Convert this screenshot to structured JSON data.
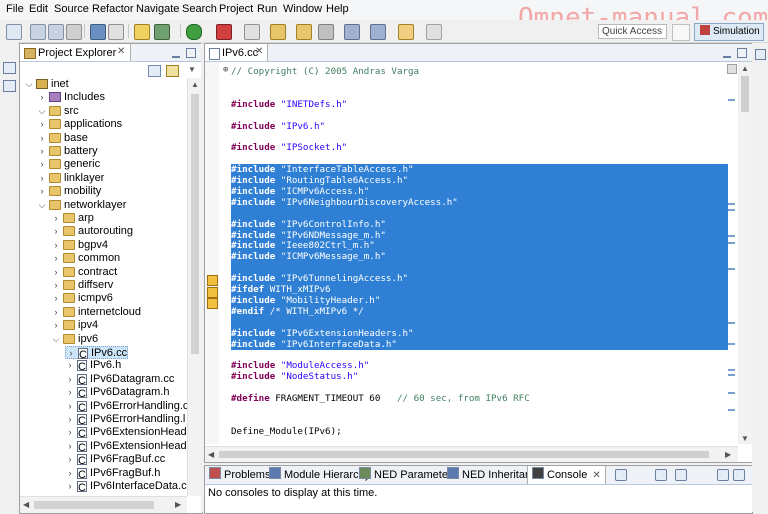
{
  "menu": [
    "File",
    "Edit",
    "Source",
    "Refactor",
    "Navigate",
    "Search",
    "Project",
    "Run",
    "Window",
    "Help"
  ],
  "watermark": "Omnet-manual.com",
  "quick_access": "Quick Access",
  "perspective": "Simulation",
  "explorer": {
    "title": "Project Explorer",
    "close": "✕",
    "tree": [
      {
        "label": "inet",
        "depth": 0,
        "icon": "project",
        "twisty": "⌵"
      },
      {
        "label": "Includes",
        "depth": 1,
        "icon": "lib",
        "twisty": "›"
      },
      {
        "label": "src",
        "depth": 1,
        "icon": "folder",
        "twisty": "⌵"
      },
      {
        "label": "applications",
        "depth": 2,
        "icon": "folder",
        "twisty": "›"
      },
      {
        "label": "base",
        "depth": 2,
        "icon": "folder",
        "twisty": "›"
      },
      {
        "label": "battery",
        "depth": 2,
        "icon": "folder",
        "twisty": "›"
      },
      {
        "label": "generic",
        "depth": 2,
        "icon": "folder",
        "twisty": "›"
      },
      {
        "label": "linklayer",
        "depth": 2,
        "icon": "folder",
        "twisty": "›"
      },
      {
        "label": "mobility",
        "depth": 2,
        "icon": "folder",
        "twisty": "›"
      },
      {
        "label": "networklayer",
        "depth": 2,
        "icon": "folder",
        "twisty": "⌵"
      },
      {
        "label": "arp",
        "depth": 3,
        "icon": "folder",
        "twisty": "›"
      },
      {
        "label": "autorouting",
        "depth": 3,
        "icon": "folder",
        "twisty": "›"
      },
      {
        "label": "bgpv4",
        "depth": 3,
        "icon": "folder",
        "twisty": "›"
      },
      {
        "label": "common",
        "depth": 3,
        "icon": "folder",
        "twisty": "›"
      },
      {
        "label": "contract",
        "depth": 3,
        "icon": "folder",
        "twisty": "›"
      },
      {
        "label": "diffserv",
        "depth": 3,
        "icon": "folder",
        "twisty": "›"
      },
      {
        "label": "icmpv6",
        "depth": 3,
        "icon": "folder",
        "twisty": "›"
      },
      {
        "label": "internetcloud",
        "depth": 3,
        "icon": "folder",
        "twisty": "›"
      },
      {
        "label": "ipv4",
        "depth": 3,
        "icon": "folder",
        "twisty": "›"
      },
      {
        "label": "ipv6",
        "depth": 3,
        "icon": "folder",
        "twisty": "⌵"
      },
      {
        "label": "IPv6.cc",
        "depth": 4,
        "icon": "file",
        "twisty": "›",
        "selected": true
      },
      {
        "label": "IPv6.h",
        "depth": 4,
        "icon": "file",
        "twisty": "›"
      },
      {
        "label": "IPv6Datagram.cc",
        "depth": 4,
        "icon": "file",
        "twisty": "›"
      },
      {
        "label": "IPv6Datagram.h",
        "depth": 4,
        "icon": "file",
        "twisty": "›"
      },
      {
        "label": "IPv6ErrorHandling.c",
        "depth": 4,
        "icon": "file",
        "twisty": "›"
      },
      {
        "label": "IPv6ErrorHandling.l",
        "depth": 4,
        "icon": "file",
        "twisty": "›"
      },
      {
        "label": "IPv6ExtensionHead",
        "depth": 4,
        "icon": "file",
        "twisty": "›"
      },
      {
        "label": "IPv6ExtensionHead",
        "depth": 4,
        "icon": "file",
        "twisty": "›"
      },
      {
        "label": "IPv6FragBuf.cc",
        "depth": 4,
        "icon": "file",
        "twisty": "›"
      },
      {
        "label": "IPv6FragBuf.h",
        "depth": 4,
        "icon": "file",
        "twisty": "›"
      },
      {
        "label": "IPv6InterfaceData.c",
        "depth": 4,
        "icon": "file",
        "twisty": "›"
      }
    ]
  },
  "editor": {
    "tab": "IPv6.cc",
    "close": "✕",
    "fold": "⊕",
    "lines": [
      {
        "line": 0,
        "text": "// Copyright (C) 2005 Andras Varga",
        "kind": "cm",
        "hl": false
      },
      {
        "line": 3,
        "kw": "#include",
        "rest": " \"INETDefs.h\"",
        "hl": false
      },
      {
        "line": 5,
        "kw": "#include",
        "rest": " \"IPv6.h\"",
        "hl": false
      },
      {
        "line": 7,
        "kw": "#include",
        "rest": " \"IPSocket.h\"",
        "hl": false
      },
      {
        "line": 9,
        "kw": "#include",
        "rest": " \"InterfaceTableAccess.h\"",
        "hl": true
      },
      {
        "line": 10,
        "kw": "#include",
        "rest": " \"RoutingTable6Access.h\"",
        "hl": true
      },
      {
        "line": 11,
        "kw": "#include",
        "rest": " \"ICMPv6Access.h\"",
        "hl": true
      },
      {
        "line": 12,
        "kw": "#include",
        "rest": " \"IPv6NeighbourDiscoveryAccess.h\"",
        "hl": true
      },
      {
        "line": 13,
        "kw": "",
        "rest": "",
        "hl": true
      },
      {
        "line": 14,
        "kw": "#include",
        "rest": " \"IPv6ControlInfo.h\"",
        "hl": true
      },
      {
        "line": 15,
        "kw": "#include",
        "rest": " \"IPv6NDMessage_m.h\"",
        "hl": true
      },
      {
        "line": 16,
        "kw": "#include",
        "rest": " \"Ieee802Ctrl_m.h\"",
        "hl": true
      },
      {
        "line": 17,
        "kw": "#include",
        "rest": " \"ICMPv6Message_m.h\"",
        "hl": true
      },
      {
        "line": 18,
        "kw": "",
        "rest": "",
        "hl": true
      },
      {
        "line": 19,
        "kw": "#include",
        "rest": " \"IPv6TunnelingAccess.h\"",
        "hl": true
      },
      {
        "line": 20,
        "kw": "#ifdef",
        "rest": " WITH_xMIPv6",
        "hl": true
      },
      {
        "line": 21,
        "kw": "#include",
        "rest": " \"MobilityHeader.h\"",
        "hl": true
      },
      {
        "line": 22,
        "kw": "#endif",
        "rest": " /* WITH_xMIPv6 */",
        "hl": true
      },
      {
        "line": 23,
        "kw": "",
        "rest": "",
        "hl": true
      },
      {
        "line": 24,
        "kw": "#include",
        "rest": " \"IPv6ExtensionHeaders.h\"",
        "hl": true
      },
      {
        "line": 25,
        "kw": "#include",
        "rest": " \"IPv6InterfaceData.h\"",
        "hl": true
      },
      {
        "line": 27,
        "kw": "#include",
        "rest": " \"ModuleAccess.h\"",
        "hl": false
      },
      {
        "line": 28,
        "kw": "#include",
        "rest": " \"NodeStatus.h\"",
        "hl": false
      },
      {
        "line": 30,
        "kw": "#define",
        "rest": " FRAGMENT_TIMEOUT 60   ",
        "comment": "// 60 sec, from IPv6 RFC",
        "hl": false
      },
      {
        "line": 33,
        "kw": "",
        "rest": "Define_Module(IPv6);",
        "hl": false
      }
    ]
  },
  "console_tabs": [
    {
      "label": "Problems",
      "color": "#c05050"
    },
    {
      "label": "Module Hierarchy",
      "color": "#5a7ab0"
    },
    {
      "label": "NED Parameters",
      "color": "#6a8a5a"
    },
    {
      "label": "NED Inheritance",
      "color": "#5a7ab0"
    },
    {
      "label": "Console",
      "color": "#404040",
      "active": true
    }
  ],
  "console_close": "✕",
  "console_message": "No consoles to display at this time."
}
